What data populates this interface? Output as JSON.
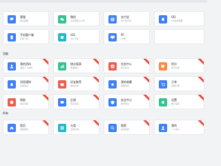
{
  "colors": {
    "blue": "#3d7ff6",
    "cyan": "#20b8c8",
    "green": "#34c38f",
    "red": "#f05b4b",
    "orange": "#ff8a3d",
    "ribbon": "#e64a3b"
  },
  "section_titles": {
    "s2": "功能",
    "s3": "所有"
  },
  "cards": [
    {
      "title": "客服",
      "desc": "联系客服",
      "color": "#3d7ff6",
      "icon": "chat-icon",
      "ribbon": false
    },
    {
      "title": "微信",
      "desc": "关注微信公众号",
      "color": "#34c38f",
      "icon": "wechat-icon",
      "ribbon": false
    },
    {
      "title": "支付宝",
      "desc": "支付宝付款",
      "color": "#3d7ff6",
      "icon": "alipay-icon",
      "ribbon": false
    },
    {
      "title": "QQ",
      "desc": "QQ在线客服",
      "color": "#3d7ff6",
      "icon": "qq-icon",
      "ribbon": false
    },
    {
      "title": "手机客户端",
      "desc": "扫码下载",
      "color": "#3d7ff6",
      "icon": "phone-icon",
      "ribbon": false
    },
    {
      "title": "iOS",
      "desc": "iOS下载",
      "color": "#20b8c8",
      "icon": "apple-icon",
      "ribbon": false
    },
    {
      "title": "PC",
      "desc": "PC端",
      "color": "#3d7ff6",
      "icon": "monitor-icon",
      "ribbon": false
    },
    {
      "title": "我的资料",
      "desc": "编辑个人资料",
      "color": "#3d7ff6",
      "icon": "user-icon",
      "ribbon": true
    },
    {
      "title": "统计报表",
      "desc": "数据统计",
      "color": "#34c38f",
      "icon": "chart-icon",
      "ribbon": true
    },
    {
      "title": "任务中心",
      "desc": "每日任务",
      "color": "#f05b4b",
      "icon": "task-icon",
      "ribbon": true
    },
    {
      "title": "积分",
      "desc": "积分兑换",
      "color": "#ff8a3d",
      "icon": "tag-icon",
      "ribbon": true
    },
    {
      "title": "消息通知",
      "desc": "系统消息",
      "color": "#3d7ff6",
      "icon": "bell-icon",
      "ribbon": true
    },
    {
      "title": "好友推荐",
      "desc": "邀请好友",
      "color": "#f05b4b",
      "icon": "gift-icon",
      "ribbon": true
    },
    {
      "title": "我的收藏",
      "desc": "收藏列表",
      "color": "#3d7ff6",
      "icon": "star-icon",
      "ribbon": true
    },
    {
      "title": "订单",
      "desc": "查看订单",
      "color": "#3d7ff6",
      "icon": "cart-icon",
      "ribbon": true
    },
    {
      "title": "帮助",
      "desc": "常见问题",
      "color": "#f05b4b",
      "icon": "help-icon",
      "ribbon": true
    },
    {
      "title": "反馈",
      "desc": "意见反馈",
      "color": "#3d7ff6",
      "icon": "feedback-icon",
      "ribbon": true
    },
    {
      "title": "安全中心",
      "desc": "账号安全",
      "color": "#3d7ff6",
      "icon": "shield-icon",
      "ribbon": true
    },
    {
      "title": "设置",
      "desc": "账户设置",
      "color": "#34c38f",
      "icon": "gear-icon",
      "ribbon": true
    },
    {
      "title": "首页",
      "desc": "返回首页",
      "color": "#3d7ff6",
      "icon": "home-icon",
      "ribbon": true
    },
    {
      "title": "分类",
      "desc": "全部分类",
      "color": "#20b8c8",
      "icon": "grid-icon",
      "ribbon": true
    },
    {
      "title": "搜索",
      "desc": "站内搜索",
      "color": "#3d7ff6",
      "icon": "search-icon",
      "ribbon": true
    },
    {
      "title": "我的",
      "desc": "个人中心",
      "color": "#3d7ff6",
      "icon": "user-icon",
      "ribbon": true
    }
  ]
}
